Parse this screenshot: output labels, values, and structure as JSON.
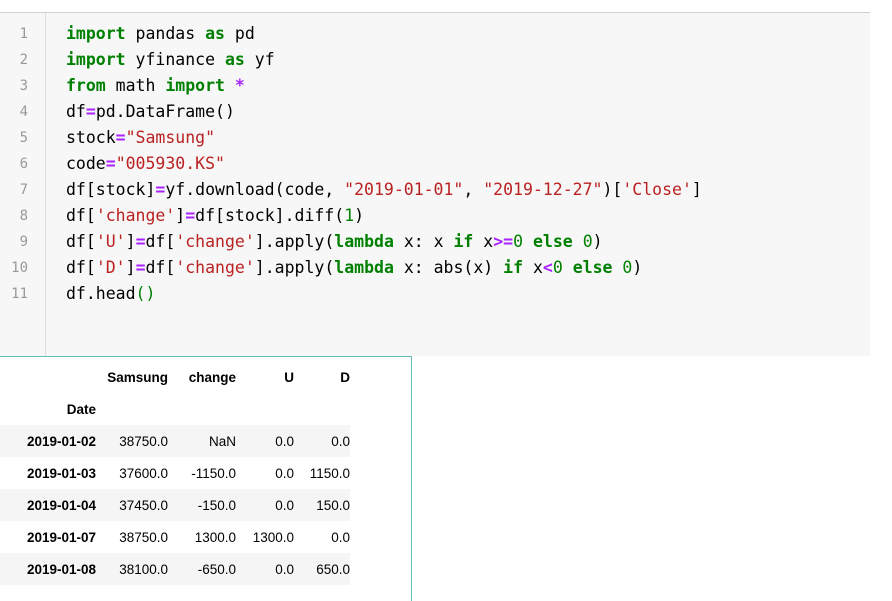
{
  "code_cell": {
    "line_numbers": [
      "1",
      "2",
      "3",
      "4",
      "5",
      "6",
      "7",
      "8",
      "9",
      "10",
      "11"
    ],
    "lines": [
      [
        {
          "t": "kw",
          "v": "import"
        },
        {
          "t": "plain",
          "v": " pandas "
        },
        {
          "t": "kw",
          "v": "as"
        },
        {
          "t": "plain",
          "v": " pd"
        }
      ],
      [
        {
          "t": "kw",
          "v": "import"
        },
        {
          "t": "plain",
          "v": " yfinance "
        },
        {
          "t": "kw",
          "v": "as"
        },
        {
          "t": "plain",
          "v": " yf"
        }
      ],
      [
        {
          "t": "kw",
          "v": "from"
        },
        {
          "t": "plain",
          "v": " math "
        },
        {
          "t": "kw",
          "v": "import"
        },
        {
          "t": "plain",
          "v": " "
        },
        {
          "t": "op",
          "v": "*"
        }
      ],
      [
        {
          "t": "plain",
          "v": "df"
        },
        {
          "t": "op",
          "v": "="
        },
        {
          "t": "plain",
          "v": "pd.DataFrame()"
        }
      ],
      [
        {
          "t": "plain",
          "v": "stock"
        },
        {
          "t": "op",
          "v": "="
        },
        {
          "t": "str",
          "v": "\"Samsung\""
        }
      ],
      [
        {
          "t": "plain",
          "v": "code"
        },
        {
          "t": "op",
          "v": "="
        },
        {
          "t": "str",
          "v": "\"005930.KS\""
        }
      ],
      [
        {
          "t": "plain",
          "v": "df[stock]"
        },
        {
          "t": "op",
          "v": "="
        },
        {
          "t": "plain",
          "v": "yf.download(code, "
        },
        {
          "t": "str",
          "v": "\"2019-01-01\""
        },
        {
          "t": "plain",
          "v": ", "
        },
        {
          "t": "str",
          "v": "\"2019-12-27\""
        },
        {
          "t": "plain",
          "v": ")["
        },
        {
          "t": "str",
          "v": "'Close'"
        },
        {
          "t": "plain",
          "v": "]"
        }
      ],
      [
        {
          "t": "plain",
          "v": "df["
        },
        {
          "t": "str",
          "v": "'change'"
        },
        {
          "t": "plain",
          "v": "]"
        },
        {
          "t": "op",
          "v": "="
        },
        {
          "t": "plain",
          "v": "df[stock].diff("
        },
        {
          "t": "num",
          "v": "1"
        },
        {
          "t": "plain",
          "v": ")"
        }
      ],
      [
        {
          "t": "plain",
          "v": "df["
        },
        {
          "t": "str",
          "v": "'U'"
        },
        {
          "t": "plain",
          "v": "]"
        },
        {
          "t": "op",
          "v": "="
        },
        {
          "t": "plain",
          "v": "df["
        },
        {
          "t": "str",
          "v": "'change'"
        },
        {
          "t": "plain",
          "v": "].apply("
        },
        {
          "t": "kw",
          "v": "lambda"
        },
        {
          "t": "plain",
          "v": " x: x "
        },
        {
          "t": "kw",
          "v": "if"
        },
        {
          "t": "plain",
          "v": " x"
        },
        {
          "t": "op",
          "v": ">="
        },
        {
          "t": "num",
          "v": "0"
        },
        {
          "t": "plain",
          "v": " "
        },
        {
          "t": "kw",
          "v": "else"
        },
        {
          "t": "plain",
          "v": " "
        },
        {
          "t": "num",
          "v": "0"
        },
        {
          "t": "plain",
          "v": ")"
        }
      ],
      [
        {
          "t": "plain",
          "v": "df["
        },
        {
          "t": "str",
          "v": "'D'"
        },
        {
          "t": "plain",
          "v": "]"
        },
        {
          "t": "op",
          "v": "="
        },
        {
          "t": "plain",
          "v": "df["
        },
        {
          "t": "str",
          "v": "'change'"
        },
        {
          "t": "plain",
          "v": "].apply("
        },
        {
          "t": "kw",
          "v": "lambda"
        },
        {
          "t": "plain",
          "v": " x: abs(x) "
        },
        {
          "t": "kw",
          "v": "if"
        },
        {
          "t": "plain",
          "v": " x"
        },
        {
          "t": "op",
          "v": "<"
        },
        {
          "t": "num",
          "v": "0"
        },
        {
          "t": "plain",
          "v": " "
        },
        {
          "t": "kw",
          "v": "else"
        },
        {
          "t": "plain",
          "v": " "
        },
        {
          "t": "num",
          "v": "0"
        },
        {
          "t": "plain",
          "v": ")"
        }
      ],
      [
        {
          "t": "plain",
          "v": "df.head"
        },
        {
          "t": "num",
          "v": "()"
        }
      ]
    ]
  },
  "output": {
    "columns": [
      "",
      "Samsung",
      "change",
      "U",
      "D"
    ],
    "index_name": "Date",
    "rows": [
      {
        "date": "2019-01-02",
        "values": [
          "38750.0",
          "NaN",
          "0.0",
          "0.0"
        ]
      },
      {
        "date": "2019-01-03",
        "values": [
          "37600.0",
          "-1150.0",
          "0.0",
          "1150.0"
        ]
      },
      {
        "date": "2019-01-04",
        "values": [
          "37450.0",
          "-150.0",
          "0.0",
          "150.0"
        ]
      },
      {
        "date": "2019-01-07",
        "values": [
          "38750.0",
          "1300.0",
          "1300.0",
          "0.0"
        ]
      },
      {
        "date": "2019-01-08",
        "values": [
          "38100.0",
          "-650.0",
          "0.0",
          "650.0"
        ]
      }
    ]
  },
  "colors": {
    "keyword": "#008000",
    "string": "#ba2121",
    "number": "#008000",
    "operator": "#aa22ff",
    "cell_background": "#f7f7f7",
    "output_border": "#66bbbb"
  }
}
